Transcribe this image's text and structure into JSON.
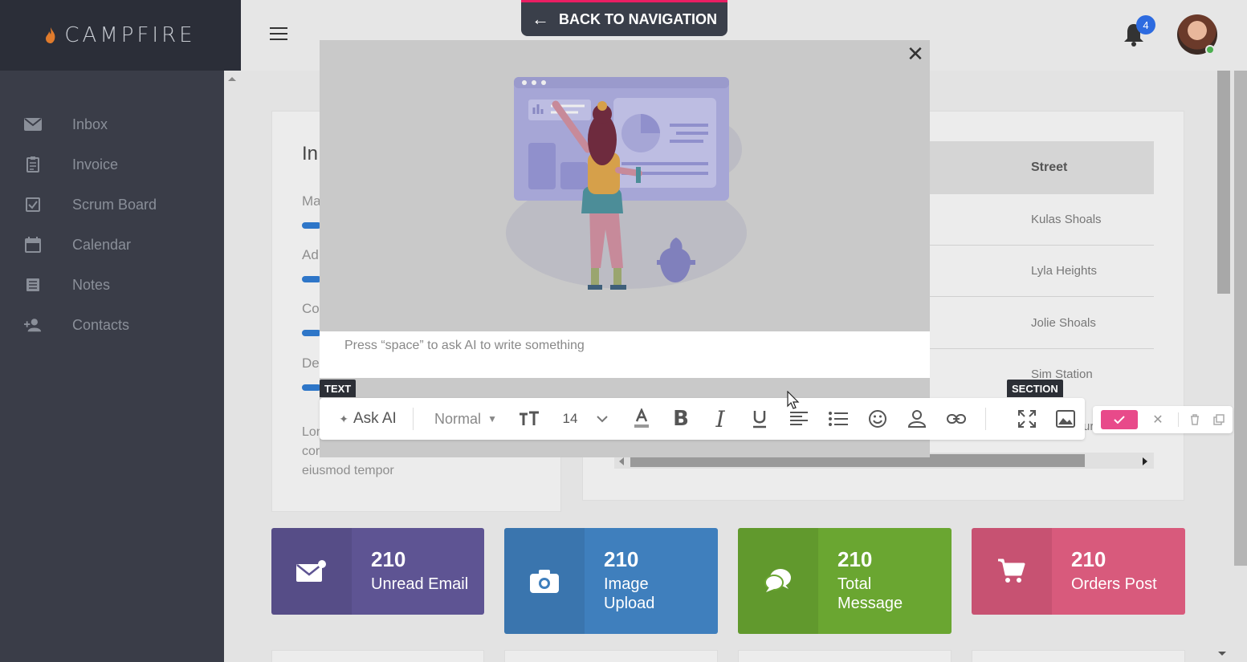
{
  "brand": {
    "name": "CAMPFIRE"
  },
  "topbar": {
    "back_label": "BACK TO NAVIGATION",
    "notification_count": "4"
  },
  "sidebar": {
    "items": [
      {
        "label": "Inbox",
        "icon": "envelope-icon"
      },
      {
        "label": "Invoice",
        "icon": "invoice-icon"
      },
      {
        "label": "Scrum Board",
        "icon": "checkbox-icon"
      },
      {
        "label": "Calendar",
        "icon": "calendar-icon"
      },
      {
        "label": "Notes",
        "icon": "notes-icon"
      },
      {
        "label": "Contacts",
        "icon": "add-user-icon"
      }
    ]
  },
  "background_card": {
    "title_fragment": "In",
    "skill_fragments": [
      "Ma",
      "Ad",
      "Co",
      "De"
    ],
    "lorem_fragments": [
      "Lor",
      "cor",
      "eiusmod tempor"
    ]
  },
  "table": {
    "header": "Street",
    "rows": [
      "Kulas Shoals",
      "Lyla Heights",
      "Jolie Shoals",
      "Sim Station"
    ],
    "partial_row": "ur"
  },
  "stats": [
    {
      "value": "210",
      "label": "Unread Email",
      "color": "#5e5493",
      "icon": "mail-icon"
    },
    {
      "value": "210",
      "label": "Image Upload",
      "color": "#3f7fbd",
      "icon": "camera-icon"
    },
    {
      "value": "210",
      "label": "Total Message",
      "color": "#6aa631",
      "icon": "chat-icon"
    },
    {
      "value": "210",
      "label": "Orders Post",
      "color": "#d85a7c",
      "icon": "cart-icon"
    }
  ],
  "editor": {
    "placeholder": "Press “space” to ask AI to write something",
    "text_tag": "TEXT",
    "section_tag": "SECTION",
    "ask_ai_label": "Ask AI",
    "style_value": "Normal",
    "font_size": "14"
  }
}
